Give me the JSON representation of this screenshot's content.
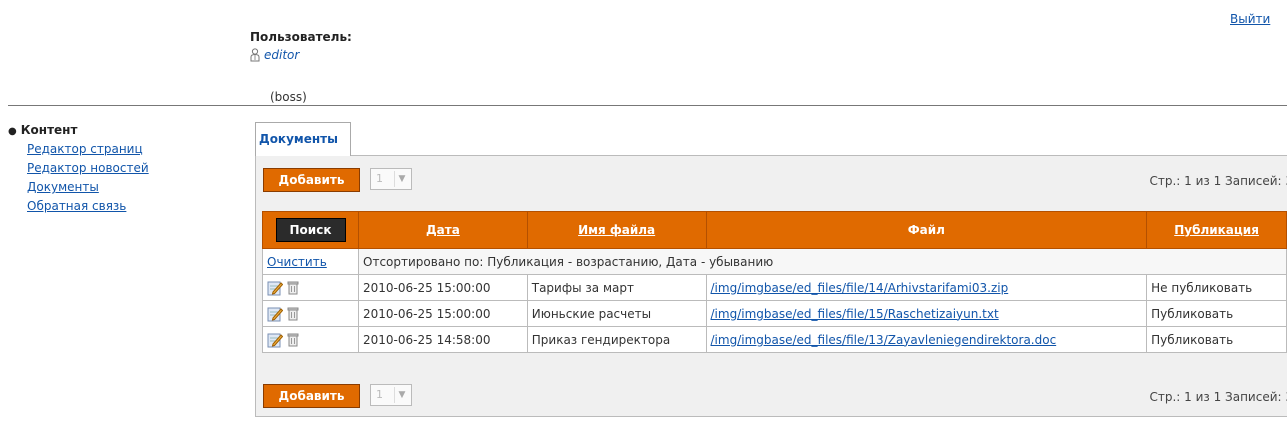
{
  "header": {
    "logout_label": "Выйти",
    "user_label": "Пользователь:",
    "user_name": "editor",
    "user_role": "(boss)"
  },
  "sidebar": {
    "section_title": "Контент",
    "items": [
      {
        "label": "Редактор страниц"
      },
      {
        "label": "Редактор новостей"
      },
      {
        "label": "Документы"
      },
      {
        "label": "Обратная связь"
      }
    ]
  },
  "tab": {
    "label": "Документы"
  },
  "toolbar": {
    "add_label": "Добавить",
    "page_value": "1",
    "pager_text": "Стр.: 1 из 1  Записей: 3"
  },
  "table": {
    "search_label": "Поиск",
    "columns": [
      "Дата",
      "Имя файла",
      "Файл",
      "Публикация"
    ],
    "clear_label": "Очистить",
    "sort_text": "Отсортировано по: Публикация - возрастанию, Дата - убыванию",
    "rows": [
      {
        "date": "2010-06-25 15:00:00",
        "name": "Тарифы за март",
        "file": "/img/imgbase/ed_files/file/14/Arhivstarifami03.zip",
        "publication": "Не публиковать"
      },
      {
        "date": "2010-06-25 15:00:00",
        "name": "Июньские расчеты",
        "file": "/img/imgbase/ed_files/file/15/Raschetizaiyun.txt",
        "publication": "Публиковать"
      },
      {
        "date": "2010-06-25 14:58:00",
        "name": "Приказ гендиректора",
        "file": "/img/imgbase/ed_files/file/13/Zayavleniegendirektora.doc",
        "publication": "Публиковать"
      }
    ]
  },
  "colors": {
    "accent": "#e06a00",
    "link": "#1155aa",
    "search_button": "#2b2b2b"
  },
  "icons": [
    "user-icon",
    "edit-icon",
    "trash-icon",
    "chevron-down-icon"
  ]
}
